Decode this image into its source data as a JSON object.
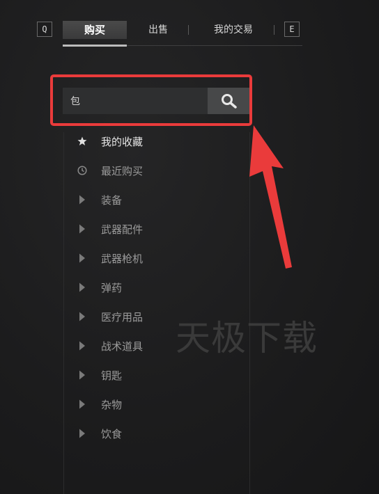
{
  "topbar": {
    "left_key": "Q",
    "right_key": "E",
    "tabs": [
      {
        "label": "购买",
        "active": true
      },
      {
        "label": "出售",
        "active": false
      },
      {
        "label": "我的交易",
        "active": false
      }
    ]
  },
  "search": {
    "value": "包"
  },
  "categories": [
    {
      "label": "我的收藏",
      "icon": "star-icon"
    },
    {
      "label": "最近购买",
      "icon": "clock-icon"
    },
    {
      "label": "装备",
      "icon": "play-triangle-icon"
    },
    {
      "label": "武器配件",
      "icon": "play-triangle-icon"
    },
    {
      "label": "武器枪机",
      "icon": "play-triangle-icon"
    },
    {
      "label": "弹药",
      "icon": "play-triangle-icon"
    },
    {
      "label": "医疗用品",
      "icon": "play-triangle-icon"
    },
    {
      "label": "战术道具",
      "icon": "play-triangle-icon"
    },
    {
      "label": "钥匙",
      "icon": "play-triangle-icon"
    },
    {
      "label": "杂物",
      "icon": "play-triangle-icon"
    },
    {
      "label": "饮食",
      "icon": "play-triangle-icon"
    }
  ],
  "watermark": "天极下载",
  "colors": {
    "highlight": "#ea3b3b",
    "background": "#1b1b1c",
    "active_tab": "#444445"
  }
}
